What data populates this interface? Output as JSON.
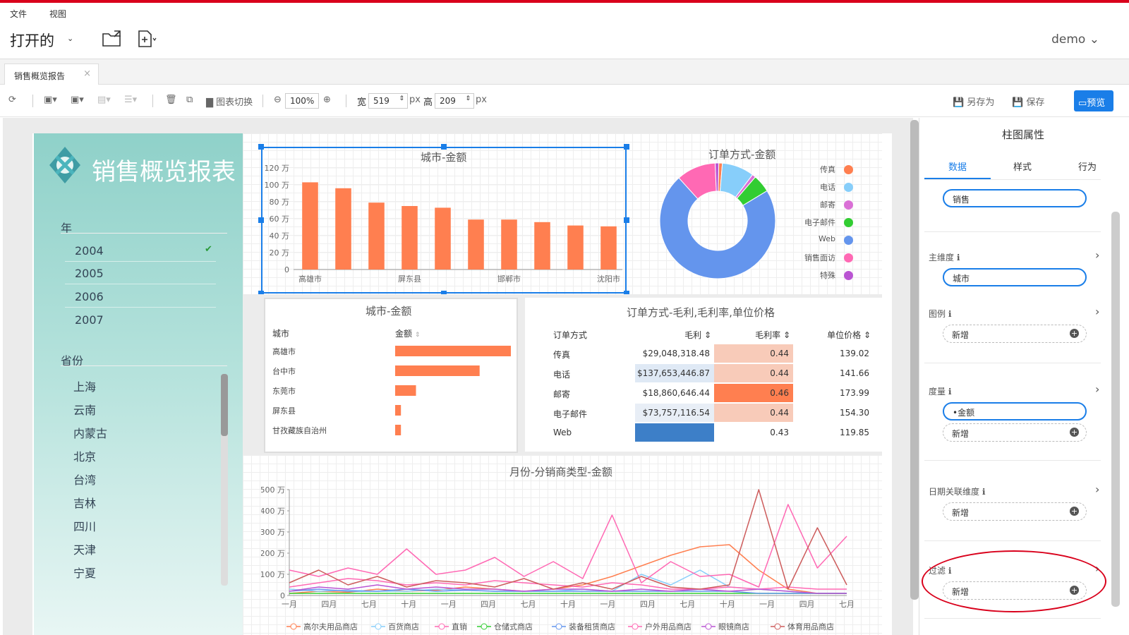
{
  "menu": {
    "file": "文件",
    "view": "视图"
  },
  "appbar": {
    "open_label": "打开的",
    "user": "demo"
  },
  "doc_tab": {
    "label": "销售概览报告",
    "close": "×"
  },
  "toolbar": {
    "chart_switch": "图表切换",
    "zoom": "100%",
    "width_label": "宽",
    "width_value": "519",
    "width_unit": "px",
    "height_label": "高",
    "height_value": "209",
    "height_unit": "px",
    "save_as": "另存为",
    "save": "保存",
    "preview": "预览"
  },
  "report": {
    "title": "销售概览报表",
    "year_section": "年",
    "years": [
      "2004",
      "2005",
      "2006",
      "2007"
    ],
    "province_section": "省份",
    "provinces": [
      "上海",
      "云南",
      "内蒙古",
      "北京",
      "台湾",
      "吉林",
      "四川",
      "天津",
      "宁夏"
    ]
  },
  "bar_chart": {
    "title": "城市-金额",
    "y_ticks": [
      "120 万",
      "100 万",
      "80 万",
      "60 万",
      "40 万",
      "20 万",
      "0"
    ],
    "x_labels": [
      "高雄市",
      "屏东县",
      "邯郸市",
      "沈阳市"
    ]
  },
  "donut": {
    "title": "订单方式-金额",
    "legend": [
      "传真",
      "电话",
      "邮寄",
      "电子邮件",
      "Web",
      "销售面访",
      "特殊"
    ]
  },
  "hbar": {
    "title": "城市-金额",
    "col_city": "城市",
    "col_amount": "金额",
    "rows": [
      "高雄市",
      "台中市",
      "东莞市",
      "屏东县",
      "甘孜藏族自治州"
    ]
  },
  "table": {
    "title": "订单方式-毛利,毛利率,单位价格",
    "headers": [
      "订单方式",
      "毛利",
      "毛利率",
      "单位价格"
    ],
    "rows": [
      [
        "传真",
        "$29,048,318.48",
        "0.44",
        "139.02"
      ],
      [
        "电话",
        "$137,653,446.87",
        "0.44",
        "141.66"
      ],
      [
        "邮寄",
        "$18,860,646.44",
        "0.46",
        "173.99"
      ],
      [
        "电子邮件",
        "$73,757,116.54",
        "0.44",
        "154.30"
      ],
      [
        "Web",
        "",
        "0.43",
        "119.85"
      ]
    ]
  },
  "line_chart": {
    "title": "月份-分销商类型-金额",
    "y_ticks": [
      "500 万",
      "400 万",
      "300 万",
      "200 万",
      "100 万",
      "0"
    ],
    "x_labels": [
      "一月",
      "四月",
      "七月",
      "十月",
      "一月",
      "四月",
      "七月",
      "十月",
      "一月",
      "四月",
      "七月",
      "十月",
      "一月",
      "四月",
      "七月"
    ],
    "legend": [
      "高尔夫用品商店",
      "百货商店",
      "直销",
      "仓储式商店",
      "装备租赁商店",
      "户外用品商店",
      "眼镜商店",
      "体育用品商店"
    ]
  },
  "chart_data": [
    {
      "type": "bar",
      "title": "城市-金额",
      "categories": [
        "高雄市",
        "",
        "",
        "屏东县",
        "",
        "",
        "邯郸市",
        "",
        "",
        "沈阳市"
      ],
      "values": [
        103,
        96,
        79,
        75,
        73,
        59,
        59,
        56,
        52,
        51
      ],
      "ylim": [
        0,
        120
      ],
      "ylabel": ""
    },
    {
      "type": "pie",
      "title": "订单方式-金额",
      "categories": [
        "传真",
        "电话",
        "邮寄",
        "电子邮件",
        "Web",
        "销售面访",
        "特殊"
      ],
      "values": [
        1,
        9,
        1,
        5,
        72,
        11,
        1
      ]
    },
    {
      "type": "bar",
      "title": "城市-金额",
      "categories": [
        "高雄市",
        "台中市",
        "东莞市",
        "屏东县",
        "甘孜藏族自治州"
      ],
      "values": [
        100,
        73,
        18,
        5,
        5
      ]
    },
    {
      "type": "line",
      "title": "月份-分销商类型-金额",
      "ylim": [
        0,
        500
      ]
    }
  ],
  "props": {
    "title": "柱图属性",
    "tabs": [
      "数据",
      "样式",
      "行为"
    ],
    "source": "销售",
    "dim_label": "主维度",
    "dim_value": "城市",
    "legend_label": "图例",
    "measure_label": "度量",
    "measure_value": "•金额",
    "date_label": "日期关联维度",
    "filter_label": "过滤",
    "add": "新增"
  },
  "colors": {
    "accent": "#1a7ee8",
    "bar": "#ff7f50",
    "top": "#d9001b"
  }
}
